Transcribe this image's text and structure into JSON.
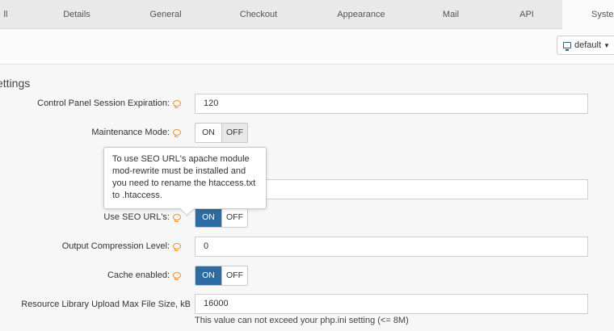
{
  "tabs": [
    {
      "label": "ll",
      "active": false
    },
    {
      "label": "Details",
      "active": false
    },
    {
      "label": "General",
      "active": false
    },
    {
      "label": "Checkout",
      "active": false
    },
    {
      "label": "Appearance",
      "active": false
    },
    {
      "label": "Mail",
      "active": false
    },
    {
      "label": "API",
      "active": false
    },
    {
      "label": "System",
      "active": true
    }
  ],
  "toolbar": {
    "theme_label": "default",
    "monitor_icon": "monitor-icon",
    "caret_icon": "caret-down-icon"
  },
  "section": {
    "title": "ettings"
  },
  "fields": {
    "session_expiration": {
      "label": "Control Panel Session Expiration:",
      "value": "120"
    },
    "maintenance_mode": {
      "label": "Maintenance Mode:",
      "on": "ON",
      "off": "OFF",
      "state": "off"
    },
    "hidden_field": {
      "value": ""
    },
    "seo_urls": {
      "label": "Use SEO URL's:",
      "on": "ON",
      "off": "OFF",
      "state": "on"
    },
    "compression_level": {
      "label": "Output Compression Level:",
      "value": "0"
    },
    "cache_enabled": {
      "label": "Cache enabled:",
      "on": "ON",
      "off": "OFF",
      "state": "on"
    },
    "upload_max_size": {
      "label": "Resource Library Upload Max File Size, kB",
      "value": "16000",
      "hint": "This value can not exceed your php.ini setting (<= 8M)"
    }
  },
  "tooltip": {
    "text": "To use SEO URL's apache module mod-rewrite must be installed and you need to rename the htaccess.txt to .htaccess."
  },
  "colors": {
    "accent": "#2d6ca2",
    "info_icon": "#f0932a"
  }
}
